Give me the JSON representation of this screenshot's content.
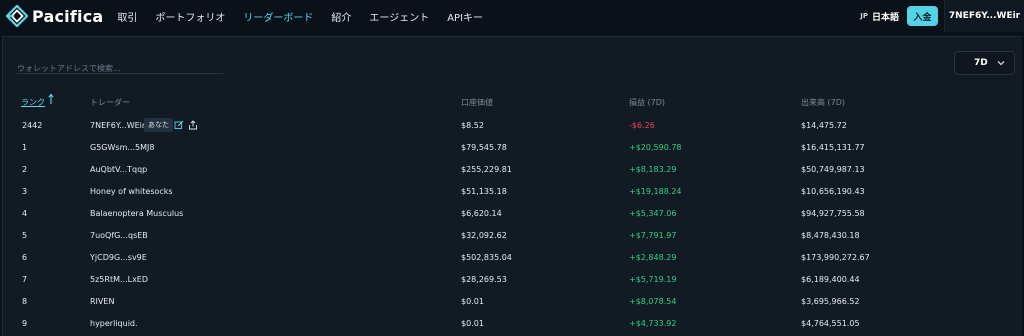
{
  "app": {
    "brand": "Pacifica"
  },
  "nav": [
    {
      "label": "取引",
      "active": false
    },
    {
      "label": "ポートフォリオ",
      "active": false
    },
    {
      "label": "リーダーボード",
      "active": true
    },
    {
      "label": "紹介",
      "active": false
    },
    {
      "label": "エージェント",
      "active": false
    },
    {
      "label": "APIキー",
      "active": false
    }
  ],
  "header": {
    "lang_code": "JP",
    "lang_label": "日本語",
    "deposit_label": "入金",
    "wallet_label": "7NEF6Y...WEir"
  },
  "search": {
    "placeholder": "ウォレットアドレスで検索..."
  },
  "period": {
    "selected": "7D"
  },
  "columns": {
    "rank": "ランク",
    "trader": "トレーダー",
    "account_value": "口座価値",
    "pnl": "損益 (7D)",
    "volume": "出来高 (7D)"
  },
  "you_badge": "あなた",
  "rows": [
    {
      "rank": "2442",
      "trader": "7NEF6Y...WEir",
      "value": "$8.52",
      "pnl": "-$6.26",
      "volume": "$14,475.72",
      "pnl_sign": "neg",
      "is_you": true
    },
    {
      "rank": "1",
      "trader": "G5GWsm...5MJ8",
      "value": "$79,545.78",
      "pnl": "+$20,590.78",
      "volume": "$16,415,131.77",
      "pnl_sign": "pos",
      "is_you": false
    },
    {
      "rank": "2",
      "trader": "AuQbtV...Tqqp",
      "value": "$255,229.81",
      "pnl": "+$8,183.29",
      "volume": "$50,749,987.13",
      "pnl_sign": "pos",
      "is_you": false
    },
    {
      "rank": "3",
      "trader": "Honey of whitesocks",
      "value": "$51,135.18",
      "pnl": "+$19,188.24",
      "volume": "$10,656,190.43",
      "pnl_sign": "pos",
      "is_you": false
    },
    {
      "rank": "4",
      "trader": "Balaenoptera Musculus",
      "value": "$6,620.14",
      "pnl": "+$5,347.06",
      "volume": "$94,927,755.58",
      "pnl_sign": "pos",
      "is_you": false
    },
    {
      "rank": "5",
      "trader": "7uoQfG...qsEB",
      "value": "$32,092.62",
      "pnl": "+$7,791.97",
      "volume": "$8,478,430.18",
      "pnl_sign": "pos",
      "is_you": false
    },
    {
      "rank": "6",
      "trader": "YjCD9G...sv9E",
      "value": "$502,835.04",
      "pnl": "+$2,848.29",
      "volume": "$173,990,272.67",
      "pnl_sign": "pos",
      "is_you": false
    },
    {
      "rank": "7",
      "trader": "5z5RtM...LxED",
      "value": "$28,269.53",
      "pnl": "+$5,719.19",
      "volume": "$6,189,400.44",
      "pnl_sign": "pos",
      "is_you": false
    },
    {
      "rank": "8",
      "trader": "RIVEN",
      "value": "$0.01",
      "pnl": "+$8,078.54",
      "volume": "$3,695,966.52",
      "pnl_sign": "pos",
      "is_you": false
    },
    {
      "rank": "9",
      "trader": "hyperliquid.",
      "value": "$0.01",
      "pnl": "+$4,733.92",
      "volume": "$4,764,551.05",
      "pnl_sign": "pos",
      "is_you": false
    }
  ]
}
